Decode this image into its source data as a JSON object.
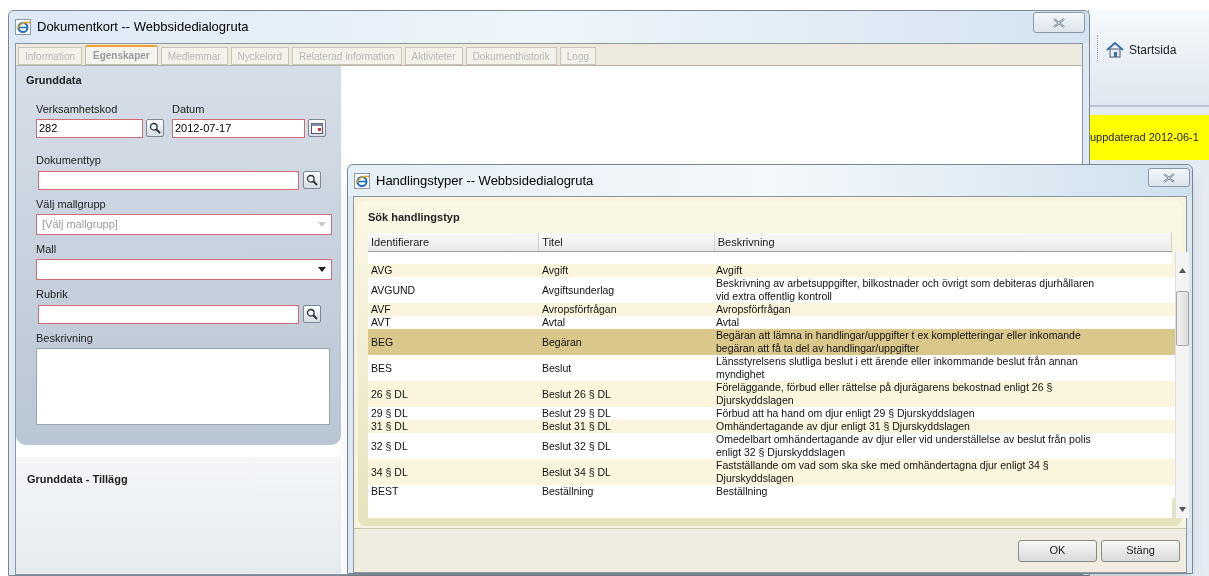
{
  "main_window": {
    "title": "Dokumentkort -- Webbsidedialogruta",
    "tabs": [
      {
        "label": "Information",
        "selected": false
      },
      {
        "label": "Egenskaper",
        "selected": true
      },
      {
        "label": "Medlemmar",
        "selected": false
      },
      {
        "label": "Nyckelord",
        "selected": false
      },
      {
        "label": "Relaterad information",
        "selected": false
      },
      {
        "label": "Aktiviteter",
        "selected": false
      },
      {
        "label": "Dokumenthistorik",
        "selected": false
      },
      {
        "label": "Logg",
        "selected": false
      }
    ],
    "grunddata": {
      "heading": "Grunddata",
      "fields": [
        {
          "kind": "text",
          "label": "Verksamhetskod",
          "value": "282",
          "required": true
        },
        {
          "kind": "date",
          "label": "Datum",
          "value": "2012-07-17",
          "required": true
        },
        {
          "kind": "text",
          "label": "Dokumenttyp",
          "required": true
        },
        {
          "kind": "select",
          "label": "Välj mallgrupp",
          "placeholder": "[Välj mallgrupp]",
          "required": true,
          "disabled": true
        },
        {
          "kind": "select",
          "label": "Mall",
          "required": true,
          "disabled": false
        },
        {
          "kind": "text",
          "label": "Rubrik",
          "required": true
        },
        {
          "kind": "textarea",
          "label": "Beskrivning",
          "required": false
        }
      ]
    },
    "tillagg_heading": "Grunddata - Tillägg"
  },
  "side": {
    "home_button": "Startsida",
    "notice": "uppdaterad 2012-06-1"
  },
  "dialog": {
    "title": "Handlingstyper -- Webbsidedialogruta",
    "heading": "Sök handlingstyp",
    "table": {
      "columns": [
        "Identifierare",
        "Titel",
        "Beskrivning"
      ],
      "rows": [
        {
          "id": "AVG",
          "title": "Avgift",
          "description": "Avgift",
          "selected": false
        },
        {
          "id": "AVGUND",
          "title": "Avgiftsunderlag",
          "description": "Beskrivning av arbetsuppgifter, bilkostnader och övrigt som debiteras djurhållaren\nvid extra offentlig kontroll",
          "selected": false
        },
        {
          "id": "AVF",
          "title": "Avropsförfrågan",
          "description": "Avropsförfrågan",
          "selected": false
        },
        {
          "id": "AVT",
          "title": "Avtal",
          "description": "Avtal",
          "selected": false
        },
        {
          "id": "BEG",
          "title": "Begäran",
          "description": "Begäran att lämna in handlingar/uppgifter t ex kompletteringar eller inkomande\nbegäran att få ta del av handlingar/uppgifter",
          "selected": true
        },
        {
          "id": "BES",
          "title": "Beslut",
          "description": "Länsstyrelsens slutliga beslut i ett ärende eller inkommande beslut från annan\nmyndighet",
          "selected": false
        },
        {
          "id": "26 § DL",
          "title": "Beslut 26 § DL",
          "description": "Föreläggande, förbud eller rättelse på djurägarens bekostnad enligt 26 §\nDjurskyddslagen",
          "selected": false
        },
        {
          "id": "29 § DL",
          "title": "Beslut 29 § DL",
          "description": "Förbud att ha hand om djur enligt 29 § Djurskyddslagen",
          "selected": false
        },
        {
          "id": "31 § DL",
          "title": "Beslut 31 § DL",
          "description": "Omhändertagande av djur enligt 31 § Djurskyddslagen",
          "selected": false
        },
        {
          "id": "32 § DL",
          "title": "Beslut 32 § DL",
          "description": "Omedelbart omhändertagande av djur eller vid underställelse av beslut från polis\nenligt 32 § Djurskyddslagen",
          "selected": false
        },
        {
          "id": "34 § DL",
          "title": "Beslut 34 § DL",
          "description": "Fastställande om vad som ska ske med omhändertagna djur enligt 34 §\nDjurskyddslagen",
          "selected": false
        },
        {
          "id": "BEST",
          "title": "Beställning",
          "description": "Beställning",
          "selected": false
        }
      ]
    },
    "buttons": [
      "OK",
      "Stäng"
    ]
  }
}
